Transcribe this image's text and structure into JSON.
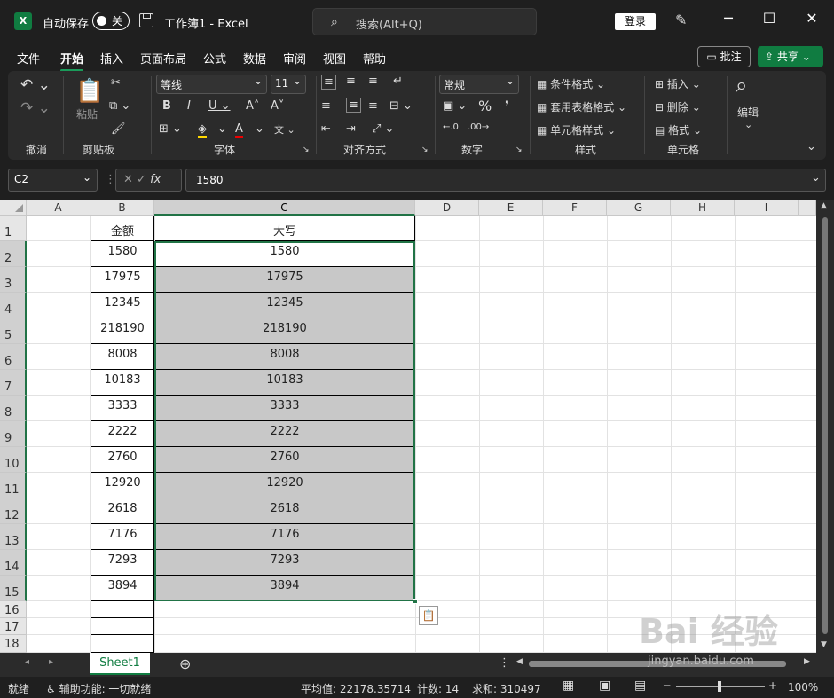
{
  "titlebar": {
    "logo": "X",
    "autosave": "自动保存",
    "toggle": "关",
    "doc": "工作簿1  -  Excel",
    "search": "搜索(Alt+Q)",
    "login": "登录",
    "min": "─",
    "max": "☐",
    "close": "✕"
  },
  "menu": [
    "文件",
    "开始",
    "插入",
    "页面布局",
    "公式",
    "数据",
    "审阅",
    "视图",
    "帮助"
  ],
  "comment_btn": "批注",
  "share_btn": "共享",
  "ribbon": {
    "groups": [
      "撤消",
      "剪贴板",
      "字体",
      "对齐方式",
      "数字",
      "样式",
      "单元格"
    ],
    "paste": "粘贴",
    "font_name": "等线",
    "font_size": "11",
    "number_format": "常规",
    "styles": [
      "条件格式",
      "套用表格格式",
      "单元格样式"
    ],
    "cells": [
      "插入",
      "删除",
      "格式"
    ],
    "edit": "编辑"
  },
  "formula": {
    "namebox": "C2",
    "fx": "fx",
    "value": "1580"
  },
  "columns": [
    "A",
    "B",
    "C",
    "D",
    "E",
    "F",
    "G",
    "H",
    "I"
  ],
  "rows": [
    "1",
    "2",
    "3",
    "4",
    "5",
    "6",
    "7",
    "8",
    "9",
    "10",
    "11",
    "12",
    "13",
    "14",
    "15",
    "16",
    "17",
    "18"
  ],
  "header_b": "金额",
  "header_c": "大写",
  "values": [
    "1580",
    "17975",
    "12345",
    "218190",
    "8008",
    "10183",
    "3333",
    "2222",
    "2760",
    "12920",
    "2618",
    "7176",
    "7293",
    "3894"
  ],
  "sheet_tab": "Sheet1",
  "status": {
    "ready": "就绪",
    "access": "辅助功能: 一切就绪",
    "avg": "平均值: 22178.35714",
    "count": "计数: 14",
    "sum": "求和: 310497",
    "zoom": "100%"
  },
  "watermark": "Bai 经验",
  "watermark2": "jingyan.baidu.com",
  "accent": "#107c41"
}
